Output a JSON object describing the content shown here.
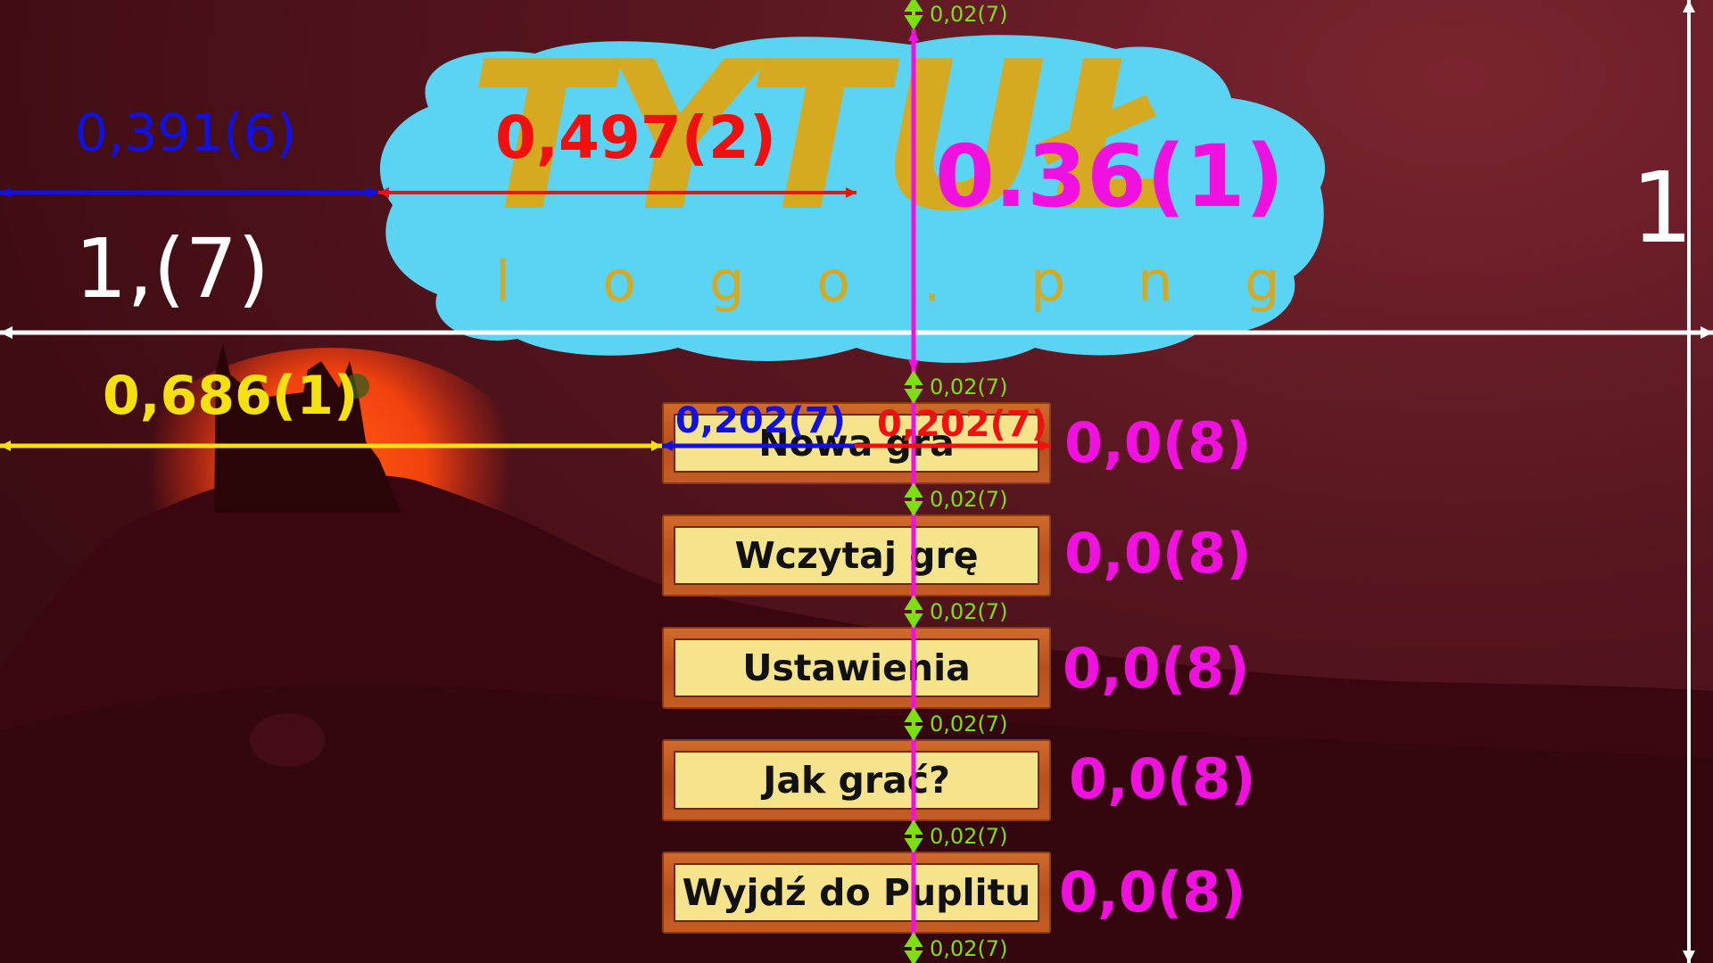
{
  "logo": {
    "title": "TYTUŁ",
    "subtitle_letters": [
      "l",
      "o",
      "g",
      "o",
      ".",
      "p",
      "n",
      "g"
    ]
  },
  "menu": {
    "buttons": [
      "Nowa gra",
      "Wczytaj grę",
      "Ustawienia",
      "Jak grać?",
      "Wyjdź do Puplitu"
    ]
  },
  "annotations": {
    "left_width_top": "0,391(6)",
    "logo_half_width": "0,497(2)",
    "logo_height": "0.36(1)",
    "logo_ratio": "1,(7)",
    "total_height": "1",
    "left_width_buttons": "0,686(1)",
    "button_half_left": "0,202(7)",
    "button_half_right": "0,202(7)",
    "button_heights": [
      "0,0(8)",
      "0,0(8)",
      "0,0(8)",
      "0,0(8)",
      "0,0(8)"
    ],
    "gap": "0,02(7)",
    "gaps_count_labels": [
      "0,02(7)",
      "0,02(7)",
      "0,02(7)",
      "0,02(7)",
      "0,02(7)",
      "0,02(7)",
      "0,02(7)"
    ]
  },
  "colors": {
    "logo_gold": "#d5a920",
    "cloud_blue": "#5ad4f2",
    "button_face": "#f5e48c",
    "button_frame": "#c05a22",
    "annot_blue": "#1010e0",
    "annot_red": "#f01010",
    "annot_magenta": "#f010e0",
    "annot_yellow": "#f5e010",
    "annot_green": "#7ce010",
    "annot_white": "#ffffff"
  }
}
